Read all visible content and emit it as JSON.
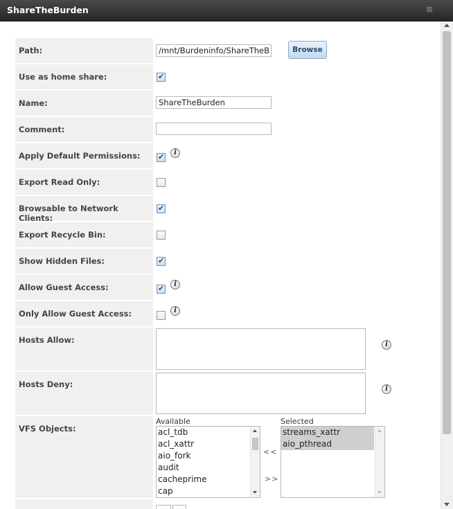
{
  "window": {
    "title": "ShareTheBurden",
    "close_glyph": "⊠"
  },
  "form": {
    "path": {
      "label": "Path:",
      "value": "/mnt/Burdeninfo/ShareTheB",
      "browse_label": "Browse"
    },
    "home_share": {
      "label": "Use as home share:",
      "checked": true
    },
    "name": {
      "label": "Name:",
      "value": "ShareTheBurden"
    },
    "comment": {
      "label": "Comment:",
      "value": ""
    },
    "default_perms": {
      "label": "Apply Default Permissions:",
      "checked": true
    },
    "read_only": {
      "label": "Export Read Only:",
      "checked": false
    },
    "browsable": {
      "label": "Browsable to Network Clients:",
      "checked": true
    },
    "recycle_bin": {
      "label": "Export Recycle Bin:",
      "checked": false
    },
    "hidden_files": {
      "label": "Show Hidden Files:",
      "checked": true
    },
    "guest_access": {
      "label": "Allow Guest Access:",
      "checked": true
    },
    "guest_only": {
      "label": "Only Allow Guest Access:",
      "checked": false
    },
    "hosts_allow": {
      "label": "Hosts Allow:",
      "value": ""
    },
    "hosts_deny": {
      "label": "Hosts Deny:",
      "value": ""
    },
    "vfs": {
      "label": "VFS Objects:",
      "available_caption": "Available",
      "selected_caption": "Selected",
      "move_left": "<<",
      "move_right": ">>",
      "available": [
        "acl_tdb",
        "acl_xattr",
        "aio_fork",
        "audit",
        "cacheprime",
        "cap"
      ],
      "selected": [
        "streams_xattr",
        "aio_pthread"
      ]
    }
  },
  "icons": {
    "info": "i",
    "check": "✔"
  },
  "colors": {
    "titlebar": "#333333",
    "label_bg": "#f0f0f0",
    "button_bg": "#c3d8ee",
    "selected_item": "#cfcfcf"
  }
}
